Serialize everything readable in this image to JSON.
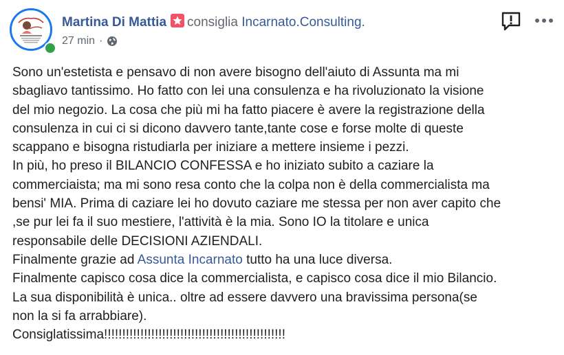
{
  "post": {
    "author": "Martina Di Mattia",
    "action": "consiglia",
    "page_name": "Incarnato.Consulting.",
    "time": "27 min",
    "time_separator": "·",
    "accent_color": "#385898",
    "badge_color": "#f25268",
    "online_color": "#31a24c",
    "icons": {
      "badge": "star-icon",
      "privacy": "globe-icon",
      "report": "report-icon",
      "menu": "more-options-icon"
    }
  },
  "body": {
    "lines": [
      "Sono un'estetista e pensavo di non avere bisogno dell'aiuto di Assunta ma mi",
      "sbagliavo tantissimo. Ho fatto con lei una consulenza e ha rivoluzionato la visione",
      "del mio negozio. La cosa che più mi ha fatto piacere è avere la registrazione della",
      "consulenza in cui ci si dicono davvero tante,tante cose e forse molte di queste",
      "scappano e bisogna ristudiarla per iniziare a mettere insieme i pezzi.",
      "In più, ho preso il BILANCIO CONFESSA e ho iniziato subito a caziare la",
      "commerciaista; ma mi sono resa conto che la colpa non è della commercialista ma",
      "bensi' MIA. Prima di caziare lei ho dovuto caziare me stessa per non aver capito che",
      ",se pur lei fa il suo mestiere, l'attività è la mia. Sono IO la titolare e unica",
      "responsabile delle DECISIONI AZIENDALI."
    ],
    "mention_line": {
      "before": "Finalmente grazie ad ",
      "mention": "Assunta Incarnato",
      "after": " tutto ha una luce diversa."
    },
    "lines_after": [
      "Finalmente capisco cosa dice la commercialista, e capisco cosa dice il mio Bilancio.",
      "La sua disponibilità è unica.. oltre ad essere davvero una bravissima persona(se",
      "non la si fa arrabbiare).",
      "Consiglatissima!!!!!!!!!!!!!!!!!!!!!!!!!!!!!!!!!!!!!!!!!!!!!!!!!!"
    ]
  }
}
